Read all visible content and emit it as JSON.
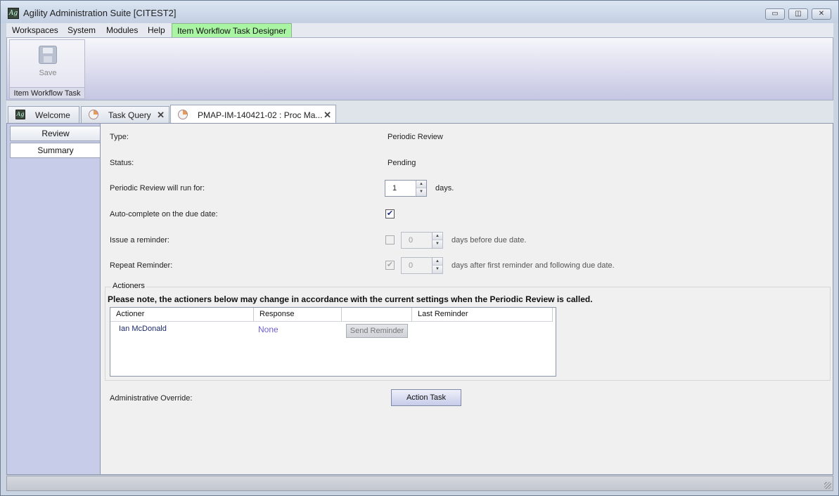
{
  "window": {
    "title": "Agility Administration Suite [CITEST2]",
    "app_icon_text": "Ag",
    "controls": {
      "minimize": "▭",
      "maximize": "◫",
      "close": "✕"
    }
  },
  "menu": {
    "items": [
      "Workspaces",
      "System",
      "Modules",
      "Help"
    ],
    "active_tab": "Item Workflow Task Designer"
  },
  "ribbon": {
    "save_label": "Save",
    "group_label": "Item Workflow Task"
  },
  "tabs": [
    {
      "label": "Welcome",
      "icon": "agility-logo-icon",
      "closable": false
    },
    {
      "label": "Task Query",
      "icon": "task-pie-icon",
      "closable": true
    },
    {
      "label": "PMAP-IM-140421-02 : Proc Ma...",
      "icon": "task-pie-icon",
      "closable": true,
      "active": true
    }
  ],
  "tab_close_glyph": "✕",
  "sidebar": {
    "items": [
      "Review",
      "Summary"
    ],
    "selected": "Summary"
  },
  "form": {
    "type_label": "Type:",
    "type_value": "Periodic Review",
    "status_label": "Status:",
    "status_value": "Pending",
    "run_for_label": "Periodic Review will run for:",
    "run_for_value": "1",
    "run_for_suffix": "days.",
    "auto_complete_label": "Auto-complete on the due date:",
    "auto_complete_checked": true,
    "reminder_label": "Issue a reminder:",
    "reminder_checked": false,
    "reminder_value": "0",
    "reminder_suffix": "days before due date.",
    "repeat_label": "Repeat Reminder:",
    "repeat_checked": true,
    "repeat_value": "0",
    "repeat_suffix": "days after first reminder and following due date.",
    "check_glyph": "✔",
    "spin_up_glyph": "▲",
    "spin_down_glyph": "▼"
  },
  "actioners": {
    "legend": "Actioners",
    "note": "Please note, the actioners below may change in accordance with the current settings when the Periodic Review is called.",
    "columns": [
      "Actioner",
      "Response",
      "",
      "Last Reminder"
    ],
    "rows": [
      {
        "actioner": "Ian McDonald",
        "response": "None",
        "button": "Send Reminder",
        "last_reminder": ""
      }
    ]
  },
  "override": {
    "label": "Administrative Override:",
    "button": "Action Task"
  },
  "colors": {
    "active_menu_tab": "#a9f5a3",
    "response_text": "#6e5fd0",
    "actioner_text": "#1b2a6b"
  }
}
